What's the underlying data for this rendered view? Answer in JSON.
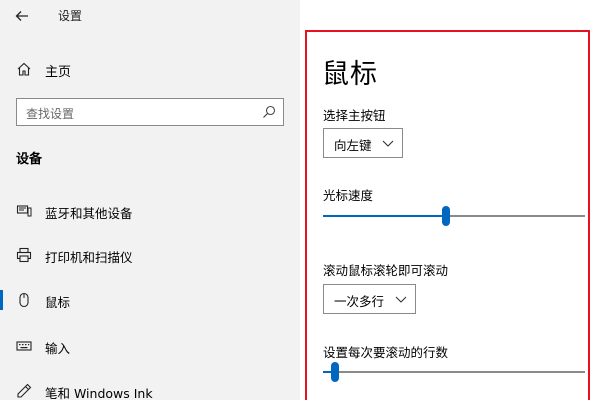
{
  "window": {
    "title": "设置"
  },
  "sidebar": {
    "home_label": "主页",
    "search_placeholder": "查找设置",
    "section_title": "设备",
    "items": [
      {
        "label": "蓝牙和其他设备",
        "icon": "bluetooth-devices-icon",
        "selected": false
      },
      {
        "label": "打印机和扫描仪",
        "icon": "printer-icon",
        "selected": false
      },
      {
        "label": "鼠标",
        "icon": "mouse-icon",
        "selected": true
      },
      {
        "label": "输入",
        "icon": "keyboard-icon",
        "selected": false
      },
      {
        "label": "笔和 Windows Ink",
        "icon": "pen-icon",
        "selected": false
      }
    ]
  },
  "main": {
    "title": "鼠标",
    "primary_button": {
      "label": "选择主按钮",
      "value": "向左键"
    },
    "cursor_speed": {
      "label": "光标速度",
      "level": 0.47
    },
    "scroll": {
      "label": "滚动鼠标滚轮即可滚动",
      "value": "一次多行"
    },
    "lines_per_scroll": {
      "label": "设置每次要滚动的行数",
      "level": 0.03
    }
  },
  "colors": {
    "accent": "#0067c0",
    "highlight_border": "#e81123",
    "sidebar_bg": "#f2f2f2"
  }
}
